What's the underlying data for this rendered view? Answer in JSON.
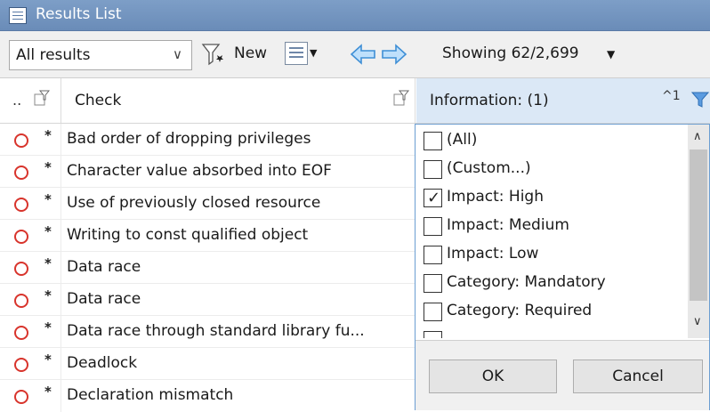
{
  "window": {
    "title": "Results List",
    "title_icon": "list-icon"
  },
  "toolbar": {
    "filter_select": "All results",
    "new_label": "New",
    "showing": "Showing 62/2,699"
  },
  "columns": {
    "dots": "..",
    "check": "Check",
    "information": "Information: (1)",
    "sort_indicator": "^1"
  },
  "rows": [
    {
      "star": "*",
      "check": "Bad order of dropping privileges"
    },
    {
      "star": "*",
      "check": "Character value absorbed into EOF"
    },
    {
      "star": "*",
      "check": "Use of previously closed resource"
    },
    {
      "star": "*",
      "check": "Writing to const qualified object"
    },
    {
      "star": "*",
      "check": "Data race"
    },
    {
      "star": "*",
      "check": "Data race"
    },
    {
      "star": "*",
      "check": "Data race through standard library fu..."
    },
    {
      "star": "*",
      "check": "Deadlock"
    },
    {
      "star": "*",
      "check": "Declaration mismatch"
    }
  ],
  "filter_popup": {
    "options": [
      {
        "label": "(All)",
        "checked": false
      },
      {
        "label": "(Custom...)",
        "checked": false
      },
      {
        "label": "Impact: High",
        "checked": true
      },
      {
        "label": "Impact: Medium",
        "checked": false
      },
      {
        "label": "Impact: Low",
        "checked": false
      },
      {
        "label": "Category: Mandatory",
        "checked": false
      },
      {
        "label": "Category: Required",
        "checked": false
      },
      {
        "label": "",
        "checked": false
      }
    ],
    "ok_label": "OK",
    "cancel_label": "Cancel"
  },
  "colors": {
    "title_bar": "#6a8cb8",
    "header_highlight": "#dbe8f6",
    "status_red": "#d8342c",
    "arrow_blue": "#3f8fd6"
  }
}
